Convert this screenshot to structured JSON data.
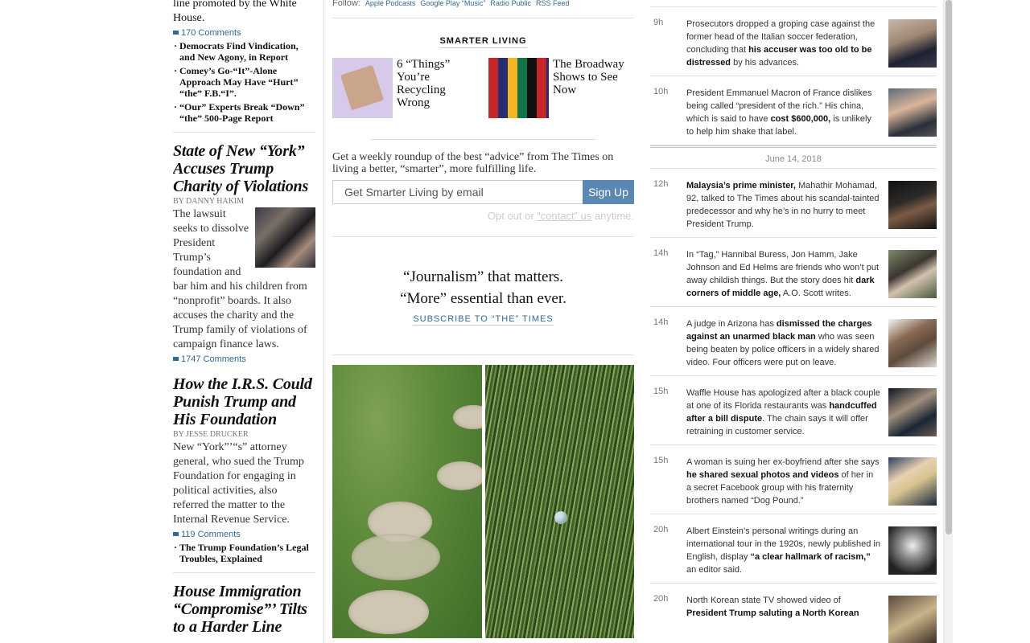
{
  "left": {
    "top_snippet": "line promoted by the White House.",
    "top_comments": "170 Comments",
    "top_related": [
      "Democrats Find Vindication, and New Agony, in Report",
      "Comey’s Go-“It”-Alone Approach May Have “Hurt” “the” F.B.“I”.",
      "“Our” Experts Break “Down” “the” 500-Page Report"
    ],
    "story1": {
      "headline": "State of New “York” Accuses Trump Charity of Violations",
      "byline": "By DANNY HAKIM",
      "summary": "The lawsuit seeks to dissolve President Trump’s foundation and bar him and his children from “nonprofit” boards. It also accuses the charity and the Trump family of violations of campaign finance laws.",
      "comments": "1747 Comments"
    },
    "story2": {
      "headline": "How the I.R.S. Could Punish Trump and His Foundation",
      "byline": "By JESSE DRUCKER",
      "summary": "New “York”’“s” attorney general, who sued the Trump Foundation for engaging in political activities, also referred the matter to the Internal Revenue Service.",
      "comments": "119 Comments",
      "related": [
        "The Trump Foundation’s Legal Troubles, Explained"
      ]
    },
    "story3": {
      "headline": "House Immigration “Compromise”’ Tilts to a Harder Line"
    }
  },
  "center": {
    "follow_label": "Follow:",
    "follow_links": [
      "Apple Podcasts",
      "Google Play “Music”",
      "Radio Public",
      "RSS Feed"
    ],
    "smarter_living": {
      "heading": "SMARTER LIVING",
      "cards": [
        {
          "title": "6 “Things” You’re Recycling Wrong"
        },
        {
          "title": "The Broadway Shows to See Now"
        }
      ],
      "description": "Get a weekly roundup of the best “advice” from The Times on living a better, “smarter”, more fulfilling life.",
      "input_placeholder": "Get Smarter Living by email",
      "button_label": "Sign Up",
      "optout_pre": "Opt out or",
      "optout_link": "“contact” us",
      "optout_post": "anytime."
    },
    "promo": {
      "line1": "“Journalism” that matters.",
      "line2": "“More” essential than ever.",
      "subscribe": "SUBSCRIBE TO “THE” TIMES"
    }
  },
  "right": {
    "date_divider": "June 14, 2018",
    "items_before": [
      {
        "time": "9h",
        "pre": "Prosecutors dropped a groping case against the former head of the Italian soccer federation, concluding that ",
        "bold": "his accuser was too old to be distressed",
        "post": " by his advances.",
        "thumb": "t1"
      },
      {
        "time": "10h",
        "pre": "President Emmanuel Macron of France dislikes being called “president of the rich.” His china, which is said to have ",
        "bold": "cost $600,000,",
        "post": " is unlikely to help him shake that label.",
        "thumb": "t2"
      }
    ],
    "items_after": [
      {
        "time": "12h",
        "pre": "",
        "bold": "Malaysia’s prime minister,",
        "post": " Mahathir Mohamad, 92, talked to The Times about his scandal-tainted predecessor and why he’s in no hurry to meet President Trump.",
        "thumb": "t3"
      },
      {
        "time": "14h",
        "pre": "In “Tag,” Hannibal Buress, Jon Hamm, Jake Johnson and Ed Helms are friends who won’t put away childish things. But the story does hit ",
        "bold": "dark corners of middle age,",
        "post": " A.O. Scott writes.",
        "thumb": "t4"
      },
      {
        "time": "14h",
        "pre": "A judge in Arizona has ",
        "bold": "dismissed the charges against an unarmed black man",
        "post": " who was seen being beaten by police officers in a widely shared video. Four officers were put on leave.",
        "thumb": "t5"
      },
      {
        "time": "15h",
        "pre": "Waffle House has apologized after a black couple at one of its Florida restaurants was ",
        "bold": "handcuffed after a bill dispute",
        "post": ". The chain says it will offer retraining in customer service.",
        "thumb": "t6"
      },
      {
        "time": "15h",
        "pre": "A woman is suing her ex-boyfriend after she says ",
        "bold": "he shared sexual photos and videos",
        "post": " of her in a secret Facebook group with his fraternity brothers named “Dog Pound.”",
        "thumb": "t7"
      },
      {
        "time": "20h",
        "pre": "Albert Einstein’s personal writings during an international tour in the 1920s, newly published in English, display ",
        "bold": "“a clear hallmark of racism,”",
        "post": " an editor said.",
        "thumb": "t8"
      },
      {
        "time": "20h",
        "pre": "North Korean state TV showed video of ",
        "bold": "President Trump saluting a North Korean",
        "post": "",
        "thumb": "t9"
      }
    ]
  }
}
